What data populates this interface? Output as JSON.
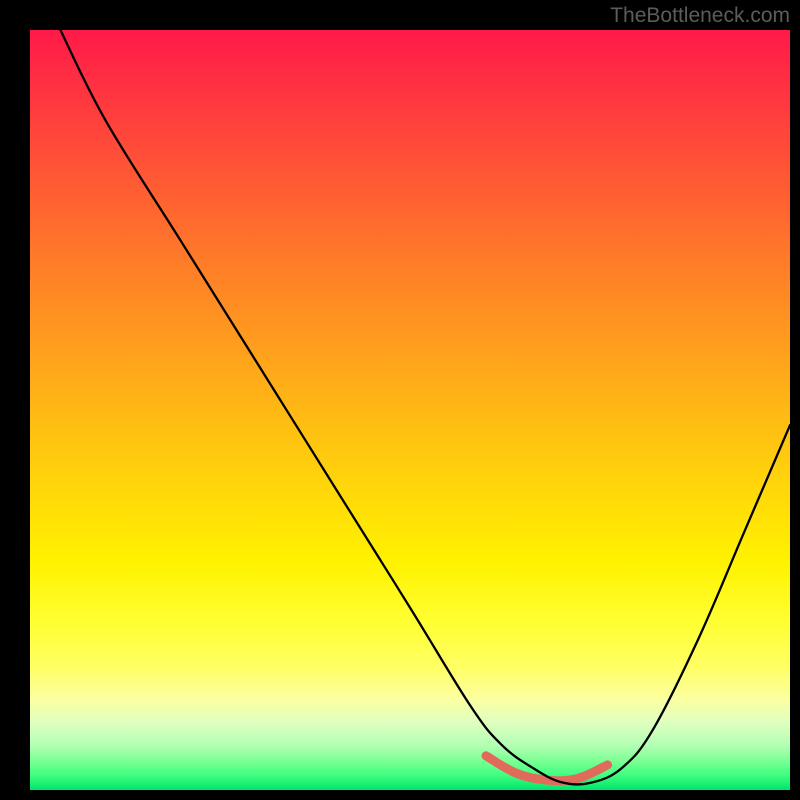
{
  "watermark": "TheBottleneck.com",
  "colors": {
    "highlight_stroke": "#e26a5b",
    "curve_stroke": "#000000",
    "gradient_top": "#ff1a49",
    "gradient_bottom": "#00e56b"
  },
  "chart_data": {
    "type": "line",
    "title": "",
    "xlabel": "",
    "ylabel": "",
    "xlim": [
      0,
      100
    ],
    "ylim": [
      0,
      100
    ],
    "grid": false,
    "series": [
      {
        "name": "curve",
        "x": [
          4,
          10,
          20,
          30,
          40,
          50,
          58,
          62,
          66,
          70,
          74,
          78,
          82,
          88,
          94,
          100
        ],
        "values": [
          100,
          88,
          72,
          56,
          40,
          24,
          11,
          6,
          3,
          1,
          1,
          3,
          8,
          20,
          34,
          48
        ]
      }
    ],
    "highlight": {
      "name": "optimal-range",
      "x": [
        60,
        64,
        68,
        72,
        76
      ],
      "values": [
        4.5,
        2.2,
        1.3,
        1.5,
        3.3
      ]
    },
    "description": "Bottleneck curve on red-to-green vertical gradient; minimum (optimal) region near x≈68-74 highlighted in salmon."
  }
}
